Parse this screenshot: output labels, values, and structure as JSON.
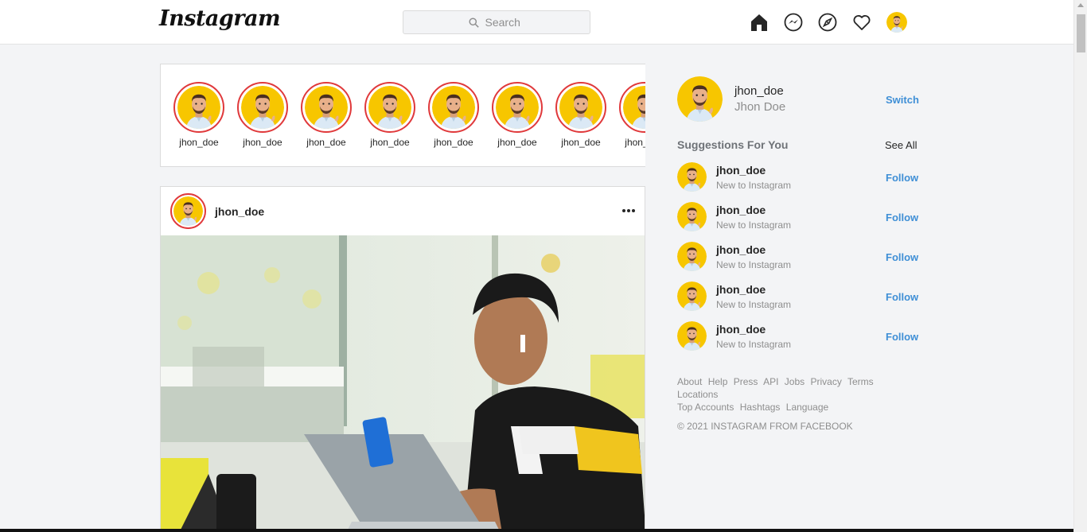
{
  "header": {
    "logo": "Instagram",
    "search_placeholder": "Search"
  },
  "stories": [
    {
      "label": "jhon_doe"
    },
    {
      "label": "jhon_doe"
    },
    {
      "label": "jhon_doe"
    },
    {
      "label": "jhon_doe"
    },
    {
      "label": "jhon_doe"
    },
    {
      "label": "jhon_doe"
    },
    {
      "label": "jhon_doe"
    },
    {
      "label": "jhon_doe"
    }
  ],
  "post": {
    "username": "jhon_doe"
  },
  "sidebar": {
    "username": "jhon_doe",
    "fullname": "Jhon Doe",
    "switch_label": "Switch",
    "suggestions_title": "Suggestions For You",
    "see_all_label": "See All",
    "suggestions": [
      {
        "username": "jhon_doe",
        "subtitle": "New to Instagram",
        "action": "Follow"
      },
      {
        "username": "jhon_doe",
        "subtitle": "New to Instagram",
        "action": "Follow"
      },
      {
        "username": "jhon_doe",
        "subtitle": "New to Instagram",
        "action": "Follow"
      },
      {
        "username": "jhon_doe",
        "subtitle": "New to Instagram",
        "action": "Follow"
      },
      {
        "username": "jhon_doe",
        "subtitle": "New to Instagram",
        "action": "Follow"
      }
    ],
    "footer_links": [
      "About",
      "Help",
      "Press",
      "API",
      "Jobs",
      "Privacy",
      "Terms",
      "Locations",
      "Top Accounts",
      "Hashtags",
      "Language"
    ],
    "copyright": "© 2021 INSTAGRAM FROM FACEBOOK"
  },
  "colors": {
    "accent": "#3f8fd6",
    "story_ring": "#e0393b",
    "avatar_bg": "#f7c600"
  }
}
